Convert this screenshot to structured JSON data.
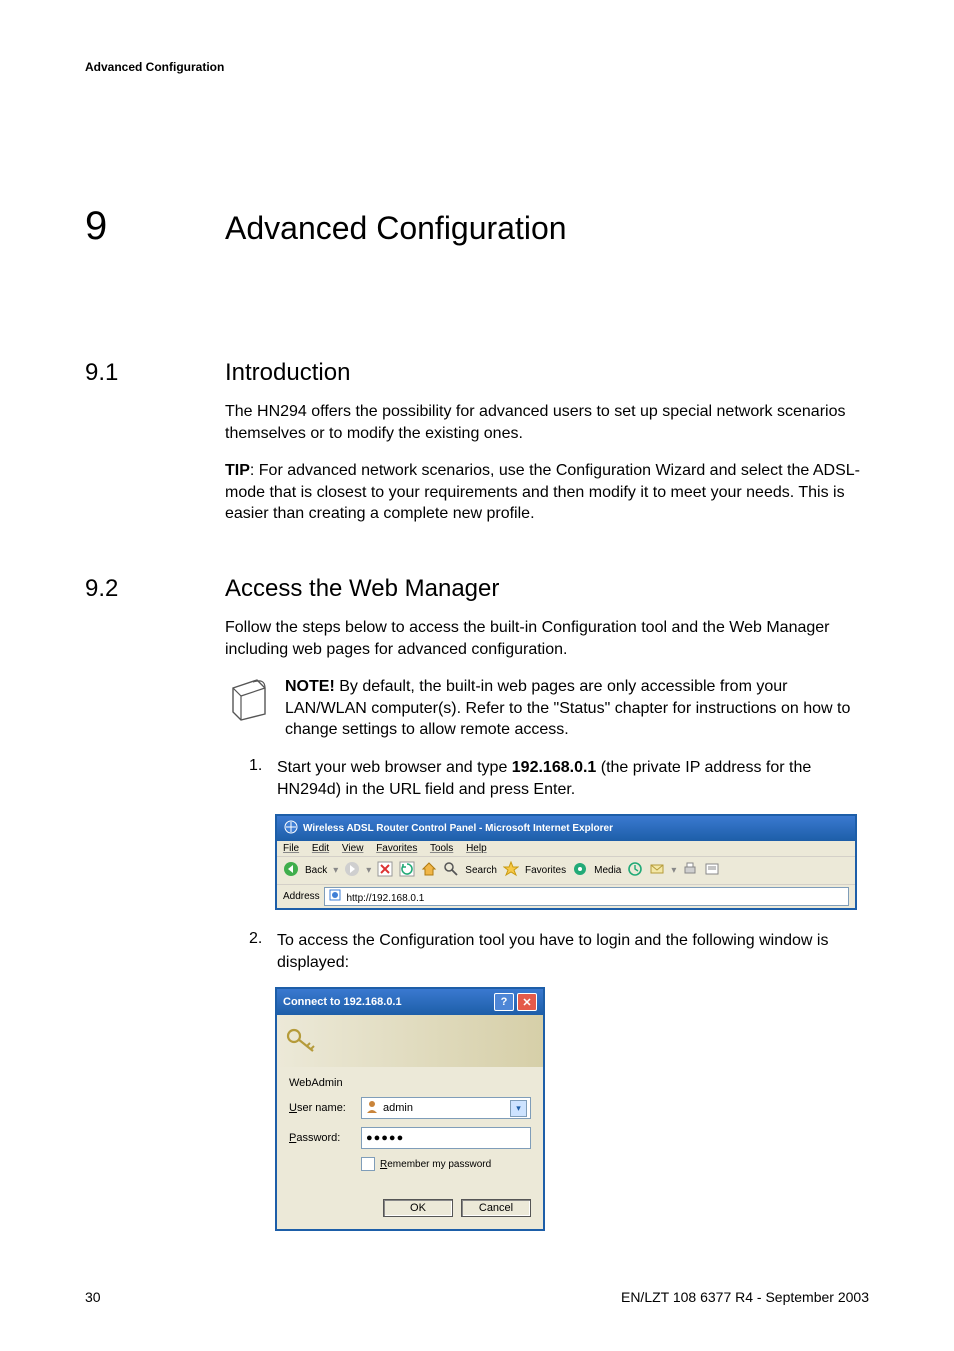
{
  "header": {
    "running": "Advanced Configuration"
  },
  "chapter": {
    "num": "9",
    "title": "Advanced Configuration"
  },
  "s1": {
    "num": "9.1",
    "title": "Introduction",
    "p1": "The HN294 offers the possibility for advanced users to set up special network scenarios themselves or to modify the existing ones.",
    "tip_label": "TIP",
    "tip_rest": ": For advanced network scenarios, use the Configuration Wizard and select the ADSL-mode that is closest to your requirements and then modify it to meet your needs. This is easier than creating a complete new profile."
  },
  "s2": {
    "num": "9.2",
    "title": "Access the Web Manager",
    "intro": "Follow the steps below to access the built-in Configuration tool and the Web Manager including web pages for advanced configuration.",
    "note_label": "NOTE!",
    "note_rest": " By default, the built-in web pages are only accessible from your LAN/WLAN computer(s). Refer to the \"Status\" chapter for instructions on how to change settings to allow remote access.",
    "step1_num": "1.",
    "step1_a": "Start your web browser and type ",
    "step1_ip": "192.168.0.1",
    "step1_b": " (the private IP address for the HN294d) in the URL field and press Enter.",
    "step2_num": "2.",
    "step2": "To access the Configuration tool you have to login and the following window is displayed:"
  },
  "ie": {
    "title": "Wireless ADSL Router Control Panel - Microsoft Internet Explorer",
    "menu": {
      "file": "File",
      "edit": "Edit",
      "view": "View",
      "favorites": "Favorites",
      "tools": "Tools",
      "help": "Help"
    },
    "toolbar": {
      "back": "Back",
      "search": "Search",
      "favorites": "Favorites",
      "media": "Media"
    },
    "address_label": "Address",
    "address_value": "http://192.168.0.1"
  },
  "login": {
    "title": "Connect to 192.168.0.1",
    "realm": "WebAdmin",
    "user_label_pre": "U",
    "user_label_rest": "ser name:",
    "pass_label_pre": "P",
    "pass_label_rest": "assword:",
    "user_value": "admin",
    "pass_value": "●●●●●",
    "remember_pre": "R",
    "remember_rest": "emember my password",
    "ok": "OK",
    "cancel": "Cancel"
  },
  "footer": {
    "page": "30",
    "id": "EN/LZT 108 6377 R4 - September 2003"
  }
}
